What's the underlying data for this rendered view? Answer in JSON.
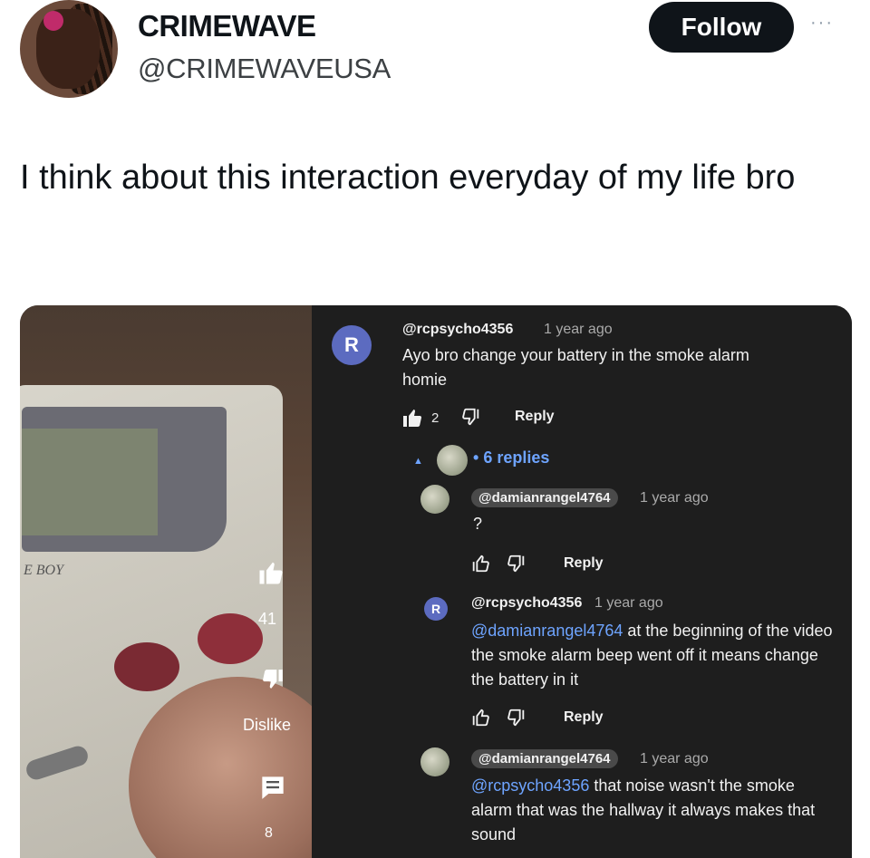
{
  "author": {
    "display_name": "CRIMEWAVE",
    "handle": "@CRIMEWAVEUSA",
    "follow_label": "Follow",
    "more_glyph": "···"
  },
  "tweet": {
    "text": "I think about this interaction everyday of my life bro"
  },
  "video_overlay": {
    "gameboy_label": "E BOY",
    "like_count": "41",
    "dislike_label": "Dislike",
    "comment_count": "8"
  },
  "comments": {
    "top": {
      "avatar_letter": "R",
      "user": "@rcpsycho4356",
      "time": "1 year ago",
      "text": "Ayo bro change your battery in the smoke alarm homie",
      "like_count": "2",
      "reply_label": "Reply"
    },
    "replies_label": "6 replies",
    "replies": [
      {
        "user": "@damianrangel4764",
        "time": "1 year ago",
        "text": "?",
        "reply_label": "Reply"
      },
      {
        "avatar_letter": "R",
        "user": "@rcpsycho4356",
        "time": "1 year ago",
        "mention": "@damianrangel4764",
        "text": " at the beginning of the video the smoke alarm beep went off it means change the battery in it",
        "reply_label": "Reply"
      },
      {
        "user": "@damianrangel4764",
        "time": "1 year ago",
        "mention": "@rcpsycho4356",
        "text": " that noise wasn't the smoke alarm that was the hallway it always makes that sound"
      }
    ]
  },
  "icons": {
    "like": "thumbs-up-icon",
    "dislike": "thumbs-down-icon",
    "comment": "comment-icon",
    "more": "more-icon"
  }
}
